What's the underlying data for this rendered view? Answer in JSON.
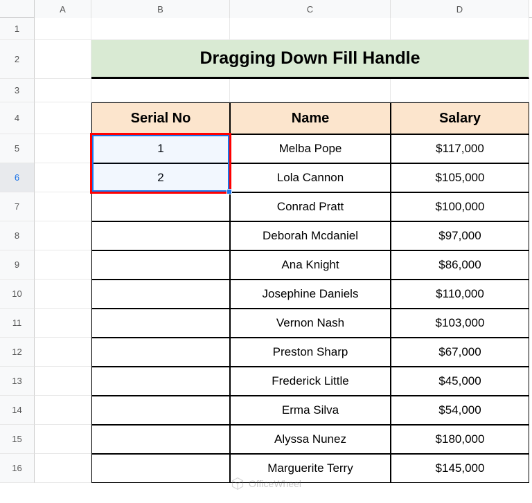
{
  "columns": [
    "A",
    "B",
    "C",
    "D"
  ],
  "col_widths": {
    "A": 82,
    "B": 200,
    "C": 232,
    "D": 200
  },
  "row_heights": {
    "1": 32,
    "2": 56,
    "3": 34,
    "4": 46,
    "5": 42,
    "6": 42,
    "7": 42,
    "8": 42,
    "9": 42,
    "10": 42,
    "11": 42,
    "12": 42,
    "13": 42,
    "14": 42,
    "15": 42,
    "16": 42
  },
  "row_labels": [
    "1",
    "2",
    "3",
    "4",
    "5",
    "6",
    "7",
    "8",
    "9",
    "10",
    "11",
    "12",
    "13",
    "14",
    "15",
    "16"
  ],
  "active_row": "6",
  "title": "Dragging Down Fill Handle",
  "headers": {
    "serial": "Serial No",
    "name": "Name",
    "salary": "Salary"
  },
  "chart_data": {
    "type": "table",
    "title": "Dragging Down Fill Handle",
    "columns": [
      "Serial No",
      "Name",
      "Salary"
    ],
    "rows": [
      {
        "serial": "1",
        "name": "Melba Pope",
        "salary": "$117,000"
      },
      {
        "serial": "2",
        "name": "Lola Cannon",
        "salary": "$105,000"
      },
      {
        "serial": "",
        "name": "Conrad Pratt",
        "salary": "$100,000"
      },
      {
        "serial": "",
        "name": "Deborah Mcdaniel",
        "salary": "$97,000"
      },
      {
        "serial": "",
        "name": "Ana Knight",
        "salary": "$86,000"
      },
      {
        "serial": "",
        "name": "Josephine Daniels",
        "salary": "$110,000"
      },
      {
        "serial": "",
        "name": "Vernon Nash",
        "salary": "$103,000"
      },
      {
        "serial": "",
        "name": "Preston Sharp",
        "salary": "$67,000"
      },
      {
        "serial": "",
        "name": "Frederick Little",
        "salary": "$45,000"
      },
      {
        "serial": "",
        "name": "Erma Silva",
        "salary": "$54,000"
      },
      {
        "serial": "",
        "name": "Alyssa Nunez",
        "salary": "$180,000"
      },
      {
        "serial": "",
        "name": "Marguerite Terry",
        "salary": "$145,000"
      }
    ]
  },
  "selection": {
    "col": "B",
    "row_start": 5,
    "row_end": 6
  },
  "watermark": "OfficeWheel"
}
